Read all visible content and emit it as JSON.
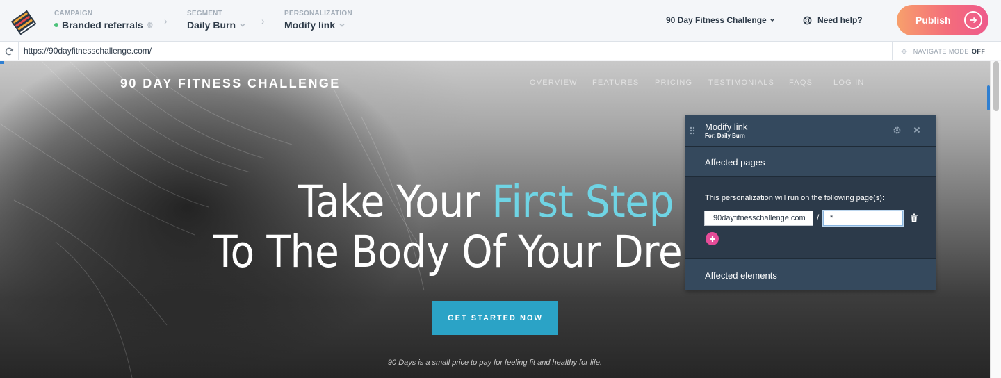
{
  "topbar": {
    "logo": "stacked-books-logo-icon",
    "campaign": {
      "label": "CAMPAIGN",
      "value": "Branded referrals",
      "status_color": "#4cc27a"
    },
    "segment": {
      "label": "SEGMENT",
      "value": "Daily Burn"
    },
    "personalization": {
      "label": "PERSONALIZATION",
      "value": "Modify link"
    },
    "site_selector": "90 Day Fitness Challenge",
    "help": "Need help?",
    "publish": "Publish"
  },
  "urlbar": {
    "url": "https://90dayfitnesschallenge.com/",
    "nav_mode_label": "NAVIGATE MODE",
    "nav_mode_value": "OFF"
  },
  "site": {
    "logo": "90 DAY FITNESS CHALLENGE",
    "nav": [
      "OVERVIEW",
      "FEATURES",
      "PRICING",
      "TESTIMONIALS",
      "FAQS",
      "LOG IN"
    ],
    "hero_line1_plain": "Take Your ",
    "hero_line1_accent": "First Step",
    "hero_line2": "To The Body Of Your Dre",
    "accent_color": "#6fd4e4",
    "cta": "GET STARTED NOW",
    "tagline": "90 Days is a small price to pay for feeling fit and healthy for life."
  },
  "panel": {
    "title": "Modify link",
    "subtitle": "For: Daily Burn",
    "affected_pages": "Affected pages",
    "run_text": "This personalization will run on the following page(s):",
    "domain_value": "90dayfitnesschallenge.com",
    "path_separator": "/",
    "path_value": "*",
    "affected_elements": "Affected elements"
  }
}
